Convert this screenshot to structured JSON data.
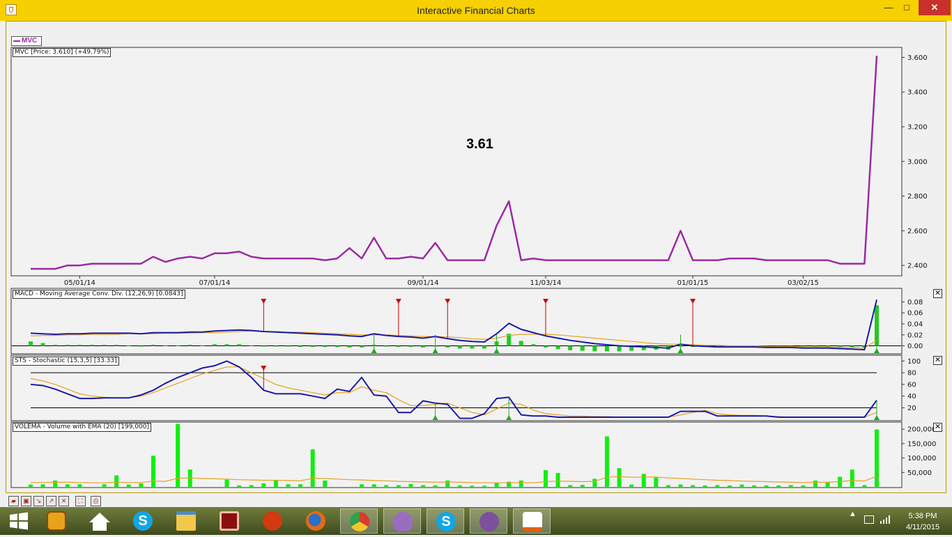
{
  "window": {
    "title": "Interactive Financial Charts",
    "controls": {
      "minimize": "—",
      "maximize": "□",
      "close": "✕"
    }
  },
  "legend": {
    "symbol": "MVC"
  },
  "panes": {
    "price_label": "MVC [Price: 3.610] (+49.79%)",
    "macd_label": "MACD - Moving Average Conv. Div. (12,26,9) [0.0843]",
    "sts_label": "STS - Stochastic (15,3,5) [33.33]",
    "volema_label": "VOLEMA - Volume with EMA (20) [199,000]",
    "close_glyph": "✕"
  },
  "current_price_display": "3.61",
  "chart_data": [
    {
      "type": "line",
      "name": "price",
      "series": [
        {
          "name": "MVC",
          "color": "#9b2aa3"
        }
      ],
      "x_ticks": [
        "05/01/14",
        "07/01/14",
        "09/01/14",
        "11/03/14",
        "01/01/15",
        "03/02/15"
      ],
      "y_ticks": [
        "2.400",
        "2.600",
        "2.800",
        "3.000",
        "3.200",
        "3.400",
        "3.600"
      ],
      "ylim": [
        2.34,
        3.65
      ],
      "values": [
        2.38,
        2.38,
        2.38,
        2.4,
        2.4,
        2.41,
        2.41,
        2.41,
        2.41,
        2.41,
        2.45,
        2.42,
        2.44,
        2.45,
        2.44,
        2.47,
        2.47,
        2.48,
        2.45,
        2.44,
        2.44,
        2.44,
        2.44,
        2.44,
        2.43,
        2.44,
        2.5,
        2.44,
        2.56,
        2.44,
        2.44,
        2.45,
        2.44,
        2.53,
        2.43,
        2.43,
        2.43,
        2.43,
        2.63,
        2.77,
        2.43,
        2.44,
        2.43,
        2.43,
        2.43,
        2.43,
        2.43,
        2.43,
        2.43,
        2.43,
        2.43,
        2.43,
        2.43,
        2.6,
        2.43,
        2.43,
        2.43,
        2.44,
        2.44,
        2.44,
        2.43,
        2.43,
        2.43,
        2.43,
        2.43,
        2.43,
        2.41,
        2.41,
        2.41,
        3.61
      ]
    },
    {
      "type": "line",
      "name": "macd",
      "y_ticks": [
        "0.00",
        "0.02",
        "0.04",
        "0.06",
        "0.08"
      ],
      "ylim": [
        -0.012,
        0.092
      ],
      "macd_color": "#1a1aa8",
      "signal_color": "#e6a020",
      "hist_color": "#22cc22",
      "sell_markers": [
        19,
        30,
        34,
        42,
        54
      ],
      "buy_markers": [
        28,
        33,
        38,
        53,
        69
      ],
      "macd": [
        0.023,
        0.022,
        0.021,
        0.022,
        0.022,
        0.023,
        0.023,
        0.023,
        0.023,
        0.022,
        0.024,
        0.024,
        0.024,
        0.025,
        0.025,
        0.027,
        0.028,
        0.029,
        0.028,
        0.026,
        0.025,
        0.024,
        0.023,
        0.022,
        0.021,
        0.02,
        0.018,
        0.017,
        0.022,
        0.019,
        0.017,
        0.016,
        0.014,
        0.017,
        0.013,
        0.01,
        0.008,
        0.007,
        0.022,
        0.041,
        0.03,
        0.024,
        0.018,
        0.014,
        0.01,
        0.007,
        0.004,
        0.002,
        0.0,
        -0.001,
        -0.002,
        -0.003,
        -0.004,
        0.003,
        0.0,
        -0.001,
        -0.002,
        -0.002,
        -0.002,
        -0.002,
        -0.003,
        -0.003,
        -0.003,
        -0.004,
        -0.004,
        -0.004,
        -0.005,
        -0.006,
        -0.007,
        0.084
      ],
      "signal": [
        0.018,
        0.019,
        0.019,
        0.02,
        0.02,
        0.021,
        0.021,
        0.021,
        0.022,
        0.022,
        0.022,
        0.023,
        0.023,
        0.023,
        0.024,
        0.024,
        0.025,
        0.026,
        0.027,
        0.026,
        0.026,
        0.025,
        0.025,
        0.024,
        0.023,
        0.022,
        0.021,
        0.02,
        0.02,
        0.02,
        0.019,
        0.018,
        0.017,
        0.017,
        0.016,
        0.015,
        0.013,
        0.012,
        0.014,
        0.019,
        0.021,
        0.021,
        0.021,
        0.02,
        0.018,
        0.016,
        0.014,
        0.012,
        0.01,
        0.008,
        0.006,
        0.004,
        0.003,
        0.003,
        0.002,
        0.001,
        0.001,
        0.0,
        0.0,
        0.0,
        -0.001,
        -0.001,
        -0.001,
        -0.002,
        -0.002,
        -0.002,
        -0.003,
        -0.003,
        -0.004,
        0.01
      ],
      "histogram": [
        0.008,
        0.005,
        0.002,
        0.002,
        0.002,
        0.002,
        0.002,
        0.002,
        0.001,
        0.0,
        0.002,
        0.001,
        0.001,
        0.002,
        0.001,
        0.003,
        0.003,
        0.003,
        0.001,
        0.0,
        -0.001,
        -0.001,
        -0.002,
        -0.002,
        -0.002,
        -0.002,
        -0.003,
        -0.003,
        0.002,
        -0.001,
        -0.002,
        -0.002,
        -0.003,
        0.0,
        -0.003,
        -0.005,
        -0.005,
        -0.005,
        0.008,
        0.022,
        0.009,
        0.003,
        -0.003,
        -0.006,
        -0.008,
        -0.009,
        -0.01,
        -0.01,
        -0.01,
        -0.009,
        -0.008,
        -0.007,
        -0.007,
        0.0,
        -0.002,
        -0.002,
        -0.003,
        -0.002,
        -0.002,
        -0.002,
        -0.002,
        -0.002,
        -0.002,
        -0.002,
        -0.002,
        -0.002,
        -0.002,
        -0.003,
        -0.003,
        0.074
      ]
    },
    {
      "type": "line",
      "name": "stochastic",
      "y_ticks": [
        "20",
        "40",
        "60",
        "80",
        "100"
      ],
      "ylim": [
        -2,
        104
      ],
      "k_color": "#1a1aa8",
      "d_color": "#e6a020",
      "levels": [
        20,
        80
      ],
      "sell_markers": [
        19
      ],
      "buy_markers": [
        33,
        39,
        69
      ],
      "k": [
        60,
        58,
        52,
        44,
        36,
        36,
        37,
        37,
        37,
        42,
        50,
        62,
        72,
        80,
        88,
        92,
        100,
        90,
        72,
        50,
        44,
        44,
        44,
        40,
        36,
        52,
        48,
        72,
        42,
        40,
        12,
        12,
        32,
        28,
        26,
        2,
        2,
        10,
        36,
        38,
        8,
        6,
        6,
        4,
        4,
        4,
        4,
        4,
        4,
        4,
        4,
        4,
        4,
        14,
        14,
        14,
        6,
        6,
        6,
        6,
        6,
        4,
        4,
        4,
        4,
        4,
        4,
        4,
        4,
        33
      ],
      "d": [
        70,
        66,
        60,
        52,
        44,
        40,
        38,
        37,
        37,
        40,
        46,
        54,
        62,
        70,
        78,
        84,
        90,
        90,
        80,
        70,
        60,
        54,
        50,
        46,
        42,
        46,
        46,
        56,
        50,
        46,
        34,
        24,
        24,
        26,
        28,
        20,
        12,
        8,
        18,
        28,
        26,
        16,
        10,
        8,
        6,
        6,
        5,
        5,
        4,
        4,
        4,
        4,
        4,
        8,
        12,
        16,
        10,
        8,
        7,
        7,
        6,
        5,
        4,
        4,
        4,
        4,
        4,
        4,
        4,
        12
      ]
    },
    {
      "type": "bar",
      "name": "volume",
      "y_ticks": [
        "50,000",
        "100,000",
        "150,000",
        "200,000"
      ],
      "ylim": [
        0,
        215000
      ],
      "bar_color": "#11ee11",
      "ema_color": "#e6a020",
      "values": [
        8000,
        9000,
        22000,
        9000,
        9000,
        0,
        9000,
        40000,
        8000,
        12000,
        108000,
        0,
        218000,
        60000,
        0,
        0,
        25000,
        5000,
        6000,
        12000,
        22000,
        9000,
        9000,
        130000,
        22000,
        0,
        0,
        9000,
        9000,
        6000,
        6000,
        10000,
        6000,
        5000,
        22000,
        5000,
        4000,
        4000,
        15000,
        18000,
        22000,
        0,
        58000,
        48000,
        6000,
        7000,
        28000,
        175000,
        65000,
        8000,
        45000,
        32000,
        6000,
        8000,
        6000,
        5000,
        6000,
        5000,
        8000,
        5000,
        5000,
        5000,
        6000,
        5000,
        22000,
        15000,
        35000,
        60000,
        6000,
        199000
      ],
      "ema": [
        15000,
        15000,
        16000,
        16000,
        15000,
        14000,
        14000,
        16000,
        15000,
        15000,
        20000,
        19000,
        30000,
        31000,
        29000,
        28000,
        27000,
        25000,
        24000,
        23000,
        23000,
        22000,
        21000,
        30000,
        29000,
        27000,
        25000,
        24000,
        22000,
        21000,
        19000,
        18000,
        17000,
        16000,
        17000,
        16000,
        15000,
        14000,
        14000,
        14000,
        15000,
        14000,
        18000,
        20000,
        19000,
        18000,
        19000,
        33000,
        36000,
        33000,
        34000,
        34000,
        31000,
        29000,
        27000,
        25000,
        23000,
        22000,
        20000,
        19000,
        18000,
        17000,
        16000,
        15000,
        16000,
        16000,
        18000,
        22000,
        20000,
        37000
      ]
    }
  ],
  "toolbar": {
    "tools": [
      "open-tool",
      "save-tool",
      "zoom-in-tool",
      "zoom-out-tool",
      "reset-tool",
      "fit-tool",
      "print-tool"
    ]
  },
  "taskbar": {
    "apps": [
      "start",
      "file-manager",
      "home",
      "skype",
      "explorer",
      "game",
      "mascot",
      "firefox",
      "chrome",
      "viber-media",
      "skype2",
      "viber",
      "java"
    ],
    "clock_time": "5:38 PM",
    "clock_date": "4/11/2015"
  }
}
